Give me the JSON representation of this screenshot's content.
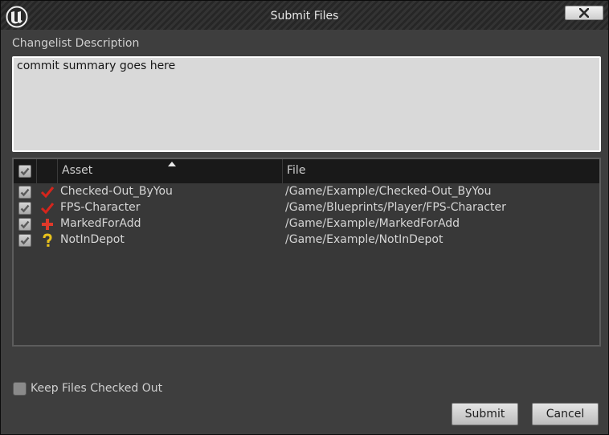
{
  "window": {
    "title": "Submit Files"
  },
  "description": {
    "label": "Changelist Description",
    "value": "commit summary goes here"
  },
  "table": {
    "columns": {
      "asset": "Asset",
      "file": "File"
    },
    "sort": "ascending",
    "rows": [
      {
        "checked": true,
        "status_icon": "checked-out-icon",
        "asset": "Checked-Out_ByYou",
        "file": "/Game/Example/Checked-Out_ByYou"
      },
      {
        "checked": true,
        "status_icon": "checked-out-icon",
        "asset": "FPS-Character",
        "file": "/Game/Blueprints/Player/FPS-Character"
      },
      {
        "checked": true,
        "status_icon": "marked-for-add-icon",
        "asset": "MarkedForAdd",
        "file": "/Game/Example/MarkedForAdd"
      },
      {
        "checked": true,
        "status_icon": "not-in-depot-icon",
        "asset": "NotInDepot",
        "file": "/Game/Example/NotInDepot"
      }
    ]
  },
  "options": {
    "keep_checked_out_label": "Keep Files Checked Out",
    "keep_checked_out": false
  },
  "buttons": {
    "submit": "Submit",
    "cancel": "Cancel"
  },
  "colors": {
    "check_red": "#d6251c",
    "question_yellow": "#e8c21c",
    "add_red": "#e0392a"
  }
}
